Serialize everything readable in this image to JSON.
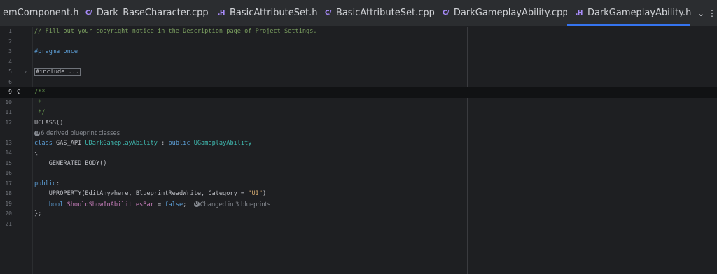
{
  "tabs": [
    {
      "icon": "",
      "label": "emComponent.h"
    },
    {
      "icon": "C/",
      "label": "Dark_BaseCharacter.cpp"
    },
    {
      "icon": ".H",
      "label": "BasicAttributeSet.h"
    },
    {
      "icon": "C/",
      "label": "BasicAttributeSet.cpp"
    },
    {
      "icon": "C/",
      "label": "DarkGameplayAbility.cpp"
    },
    {
      "icon": ".H",
      "label": "DarkGameplayAbility.h"
    }
  ],
  "tab_menu_glyph": "⌄",
  "more_glyph": "⋮",
  "editor": {
    "line_numbers": [
      "1",
      "2",
      "3",
      "4",
      "5",
      "6",
      "9",
      "10",
      "11",
      "12",
      "13",
      "14",
      "15",
      "16",
      "17",
      "18",
      "19",
      "20",
      "21"
    ],
    "lines": {
      "l1": "// Fill out your copyright notice in the Description page of Project Settings.",
      "l3a": "#pragma",
      "l3b": " once",
      "l5": "#include ...",
      "l9": "/**",
      "l10": " *",
      "l11": " */",
      "l12": "UCLASS()",
      "hint_derived": "6 derived blueprint classes",
      "l13a": "class",
      "l13b": " GAS_API ",
      "l13c": "UDarkGameplayAbility",
      "l13d": " : ",
      "l13e": "public",
      "l13f": " ",
      "l13g": "UGameplayAbility",
      "l14": "{",
      "l15": "    GENERATED_BODY()",
      "l17a": "public",
      "l17b": ":",
      "l18a": "    UPROPERTY(EditAnywhere, BlueprintReadWrite, Category = ",
      "l18b": "\"UI\"",
      "l18c": ")",
      "l19a": "    bool",
      "l19b": " ShouldShowInAbilitiesBar",
      "l19c": " = ",
      "l19d": "false",
      "l19e": ";  ",
      "hint_changed": "Changed in 3 blueprints",
      "l20": "};"
    }
  },
  "colors": {
    "background": "#1e1f22",
    "tabbar": "#2b2d30",
    "active_tab_underline": "#3574f0",
    "comment": "#7a9e5f",
    "keyword": "#5c9ed6",
    "type": "#3fb9b0",
    "string": "#c9a26d"
  }
}
